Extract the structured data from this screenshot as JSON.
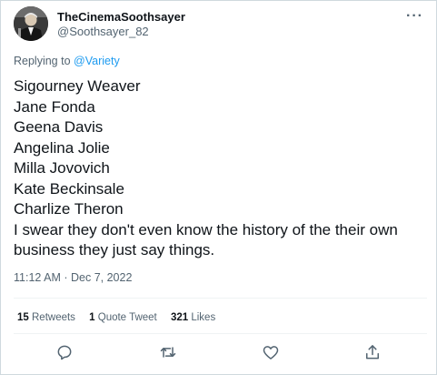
{
  "tweet": {
    "display_name": "TheCinemaSoothsayer",
    "handle": "@Soothsayer_82",
    "more_icon": "more-icon",
    "replying_prefix": "Replying to",
    "replying_mention": "@Variety",
    "lines": [
      "Sigourney Weaver",
      "Jane Fonda",
      "Geena Davis",
      "Angelina Jolie",
      "Milla Jovovich",
      "Kate Beckinsale",
      "Charlize Theron"
    ],
    "closing_text": "I swear they don't even know the  history of the their own business they just say things.",
    "timestamp": "11:12 AM · Dec 7, 2022"
  },
  "stats": {
    "retweets_count": "15",
    "retweets_label": "Retweets",
    "quotes_count": "1",
    "quotes_label": "Quote Tweet",
    "likes_count": "321",
    "likes_label": "Likes"
  },
  "actions": {
    "icons": [
      "reply-icon",
      "retweet-icon",
      "like-icon",
      "share-icon"
    ]
  },
  "colors": {
    "text": "#0f1419",
    "secondary": "#536471",
    "link": "#1d9bf0",
    "border": "#cfd9de",
    "divider": "#eff3f4"
  }
}
